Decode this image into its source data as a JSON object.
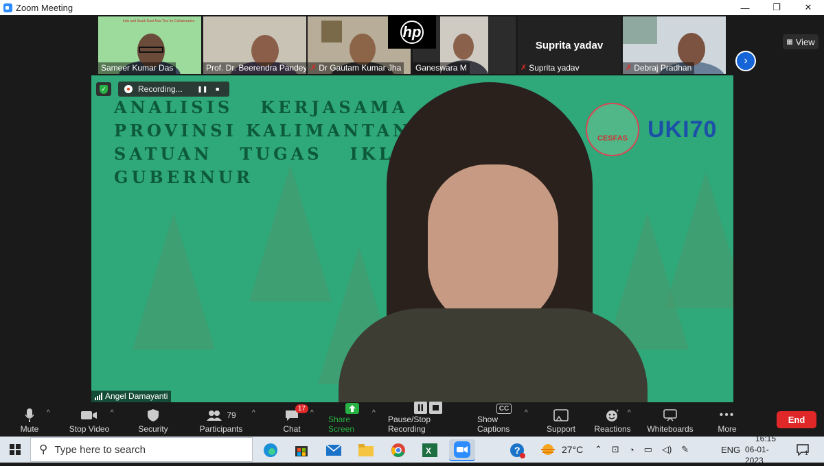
{
  "window": {
    "title": "Zoom Meeting",
    "minimize": "—",
    "restore": "❐",
    "close": "✕"
  },
  "gallery": {
    "participants": [
      {
        "name": "Sameer Kumar Das",
        "muted": false
      },
      {
        "name": "Prof. Dr. Beerendra Pandey",
        "muted": false
      },
      {
        "name": "Dr Gautam Kumar Jha",
        "muted": true
      },
      {
        "name": "Ganeswara M",
        "muted": false
      },
      {
        "name": "Suprita yadav",
        "muted": true,
        "video_off_label": "Suprita yadav"
      },
      {
        "name": "Debraj Pradhan",
        "muted": true
      }
    ],
    "view_label": "View",
    "next_icon": "chevron-right-icon",
    "thumb1_banner": "Indo and South East Asia Ties for Collaboration"
  },
  "recording": {
    "label": "Recording..."
  },
  "main_video": {
    "speaker_name": "Angel Damayanti",
    "slide_text_lines": [
      "ANALISIS   KERJASAMA   PEME",
      "PROVINSI KALIMANTAN TIMUR",
      "SATUAN   TUGAS   IKLIM   DAN",
      "GUBERNUR"
    ],
    "logo_left": "CESFAS",
    "logo_right": "UKI70"
  },
  "toolbar": {
    "items": [
      {
        "label": "Mute",
        "icon": "microphone-icon"
      },
      {
        "label": "Stop Video",
        "icon": "camera-icon"
      },
      {
        "label": "Security",
        "icon": "shield-icon"
      },
      {
        "label": "Participants",
        "icon": "people-icon",
        "count": "79"
      },
      {
        "label": "Chat",
        "icon": "chat-icon",
        "badge": "17"
      },
      {
        "label": "Share Screen",
        "icon": "share-screen-icon"
      },
      {
        "label": "Pause/Stop Recording",
        "icon": "pause-stop-icon"
      },
      {
        "label": "Show Captions",
        "icon": "cc-icon",
        "icon_text": "CC"
      },
      {
        "label": "Support",
        "icon": "support-icon"
      },
      {
        "label": "Reactions",
        "icon": "smiley-icon"
      },
      {
        "label": "Whiteboards",
        "icon": "whiteboard-icon"
      },
      {
        "label": "More",
        "icon": "more-icon"
      }
    ],
    "end_label": "End"
  },
  "taskbar": {
    "search_placeholder": "Type here to search",
    "weather": "27°C",
    "language": "ENG",
    "time": "16:15",
    "date": "06-01-2023",
    "notification_count": "1"
  },
  "colors": {
    "accent": "#2d8cff",
    "end": "#e02828",
    "share": "#27b043",
    "slide_bg": "#2fa87a"
  }
}
